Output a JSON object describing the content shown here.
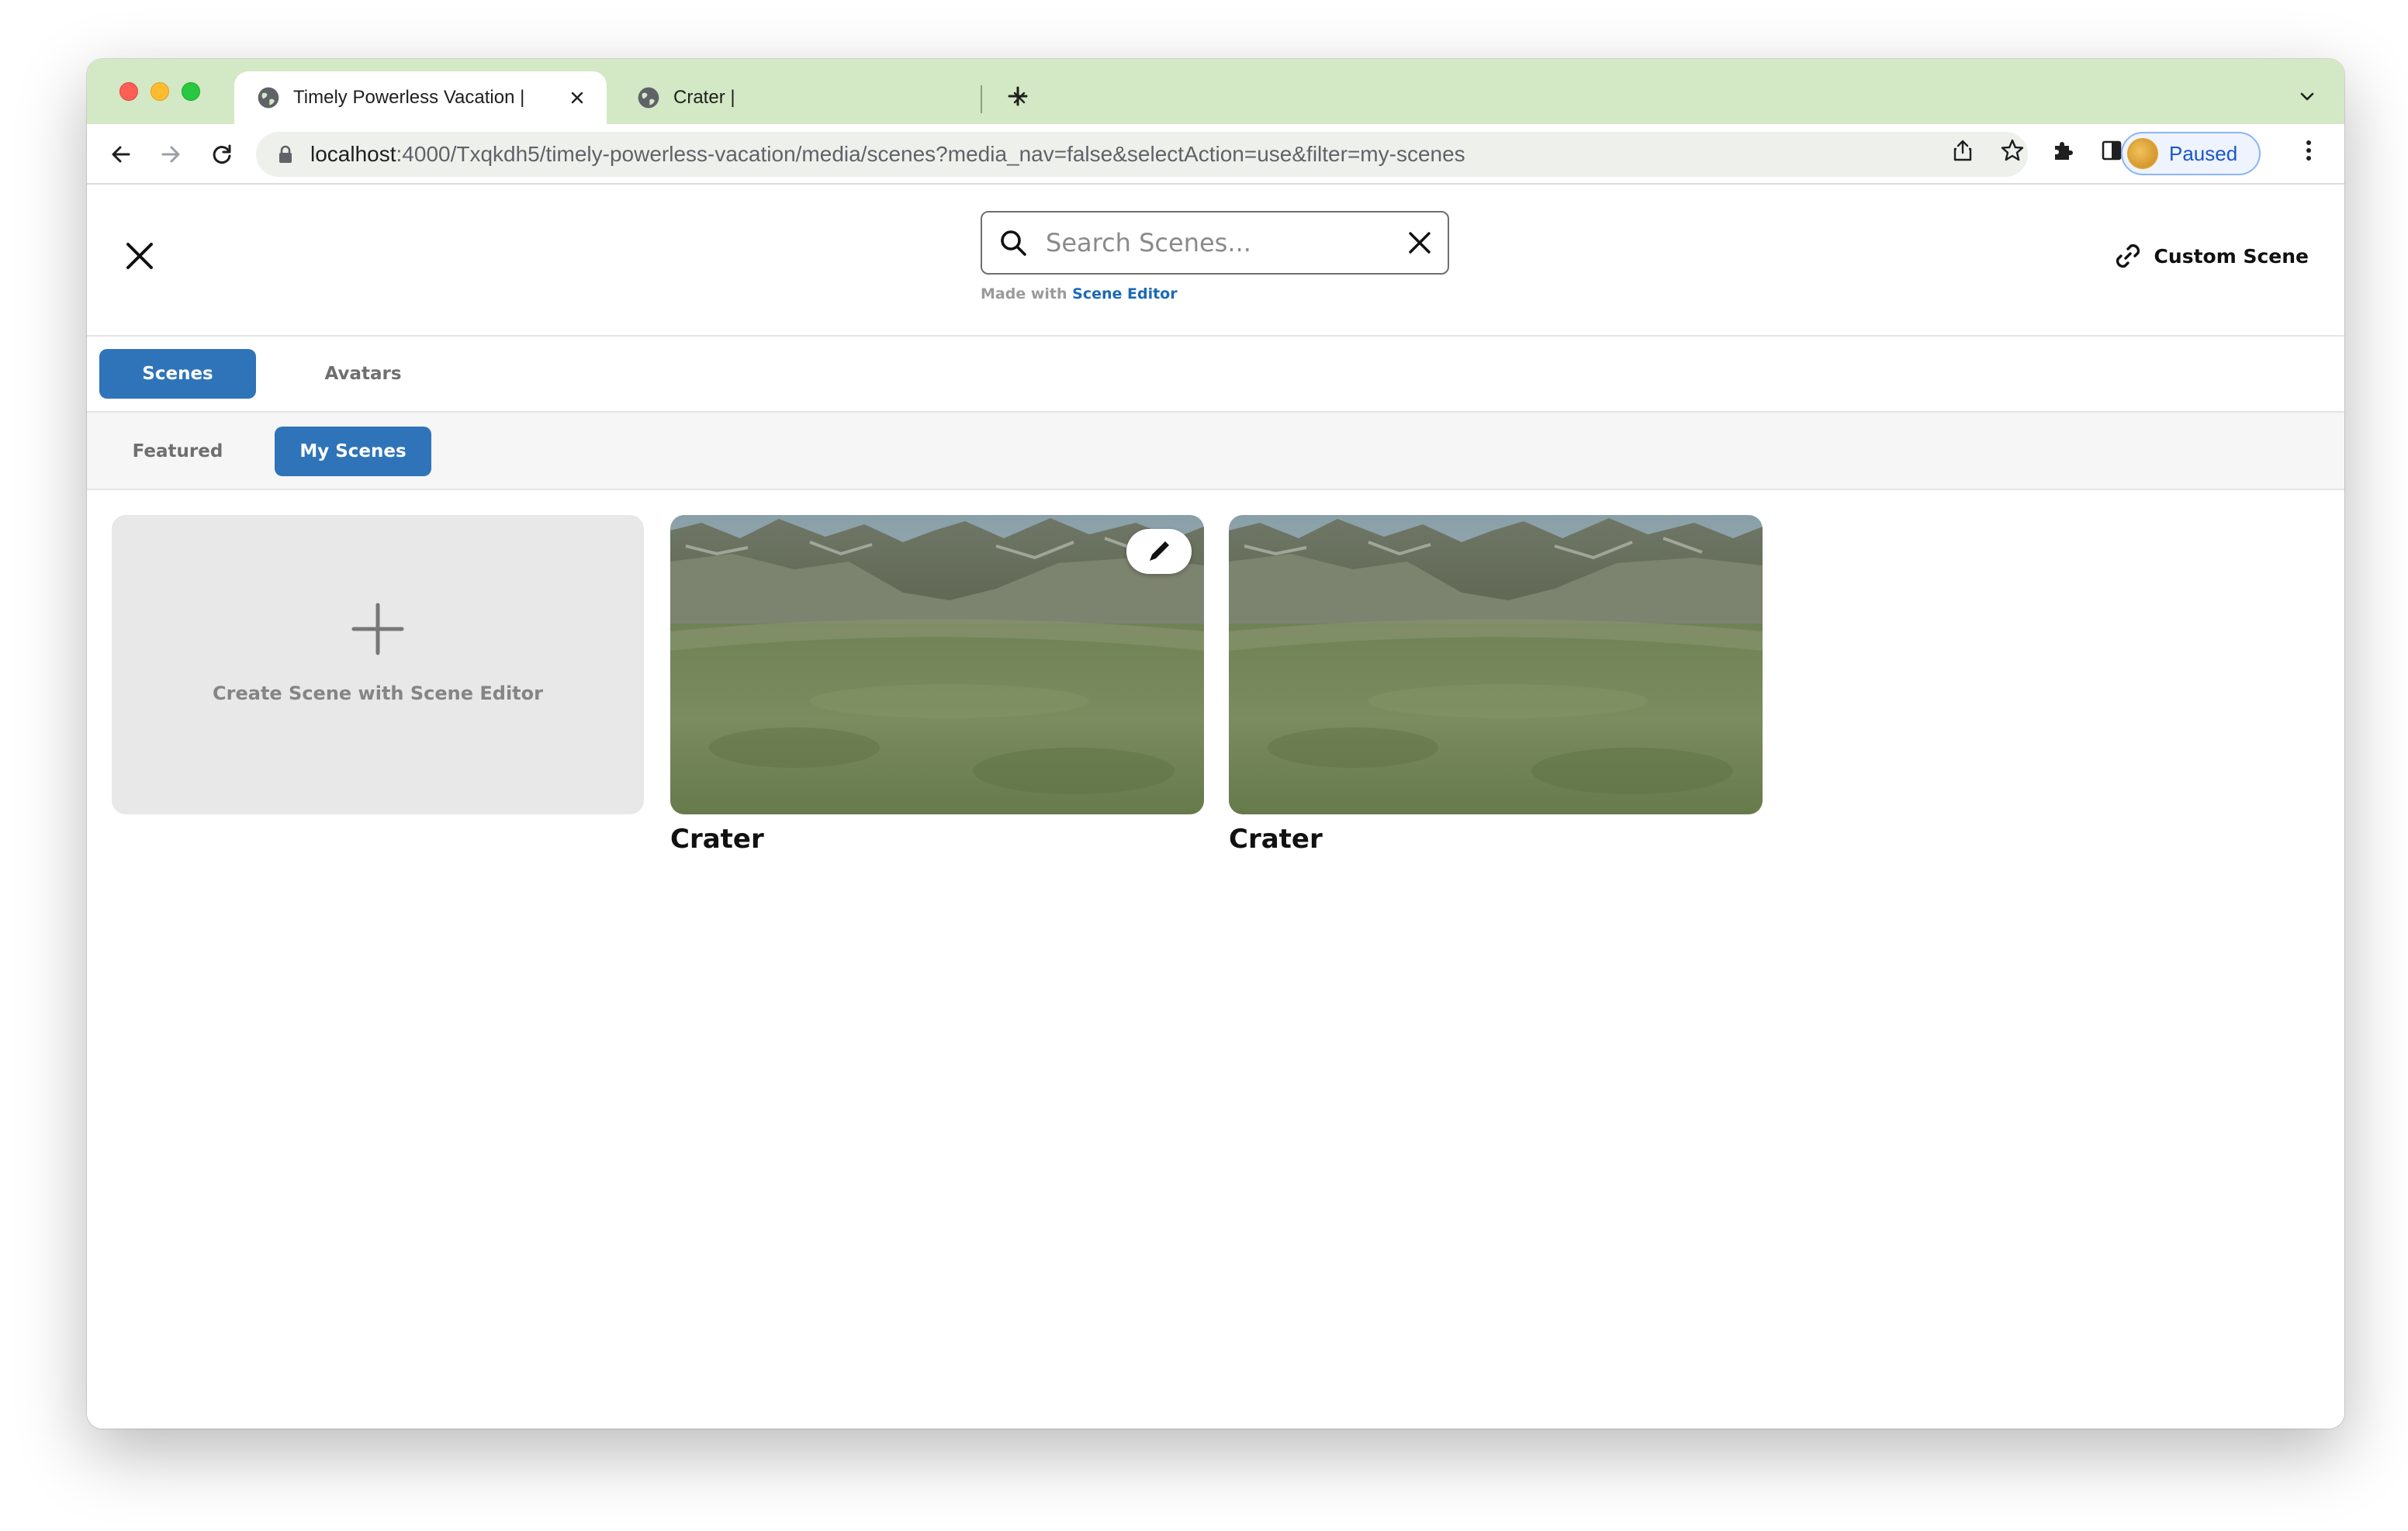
{
  "browser": {
    "tabs": [
      {
        "title": "Timely Powerless Vacation |"
      },
      {
        "title": "Crater |"
      }
    ],
    "url_host": "localhost",
    "url_path": ":4000/Txqkdh5/timely-powerless-vacation/media/scenes?media_nav=false&selectAction=use&filter=my-scenes",
    "profile_label": "Paused"
  },
  "header": {
    "search_placeholder": "Search Scenes...",
    "made_with_prefix": "Made with",
    "made_with_link": "Scene Editor",
    "custom_scene_label": "Custom Scene"
  },
  "primary_tabs": [
    {
      "label": "Scenes",
      "active": true
    },
    {
      "label": "Avatars",
      "active": false
    }
  ],
  "secondary_tabs": [
    {
      "label": "Featured",
      "active": false
    },
    {
      "label": "My Scenes",
      "active": true
    }
  ],
  "create_card": {
    "label": "Create Scene with Scene Editor"
  },
  "scenes": [
    {
      "name": "Crater",
      "editable": true
    },
    {
      "name": "Crater",
      "editable": false
    }
  ],
  "colors": {
    "accent": "#2f74b8",
    "tabstrip": "#d3e8c4",
    "link": "#1b6ab5"
  }
}
